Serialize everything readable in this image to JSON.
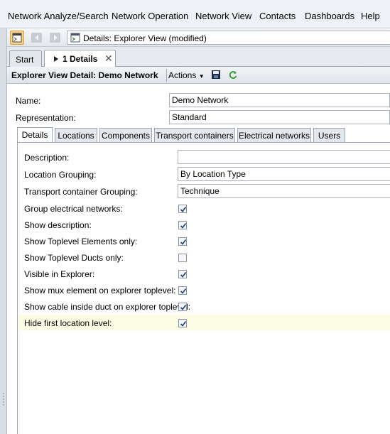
{
  "menu": {
    "items": [
      "Network Analyze/Search",
      "Network Operation",
      "Network View",
      "Contacts",
      "Dashboards",
      "Help"
    ]
  },
  "toolbar": {
    "address_text": "Details: Explorer View  (modified)",
    "icons": [
      "home-view-icon",
      "back-arrow-icon",
      "forward-arrow-icon",
      "view-page-icon"
    ]
  },
  "doc_tabs": {
    "start": "Start",
    "details": "1 Details"
  },
  "view_header": {
    "title": "Explorer View Detail: Demo Network",
    "actions": "Actions",
    "icons": [
      "save-icon",
      "refresh-icon"
    ]
  },
  "form": {
    "name_label": "Name:",
    "name_value": "Demo Network",
    "representation_label": "Representation:",
    "representation_value": "Standard"
  },
  "subtabs": [
    "Details",
    "Locations",
    "Components",
    "Transport containers",
    "Electrical networks",
    "Users"
  ],
  "details": {
    "description_label": "Description:",
    "description_value": "",
    "location_grouping_label": "Location Grouping:",
    "location_grouping_value": "By Location Type",
    "transport_grouping_label": "Transport container Grouping:",
    "transport_grouping_value": "Technique",
    "checkboxes": [
      {
        "label": "Group electrical networks:",
        "checked": true
      },
      {
        "label": "Show description:",
        "checked": true
      },
      {
        "label": "Show Toplevel Elements only:",
        "checked": true
      },
      {
        "label": "Show Toplevel Ducts only:",
        "checked": false
      },
      {
        "label": "Visible in Explorer:",
        "checked": true
      },
      {
        "label": "Show mux element on explorer toplevel:",
        "checked": true
      },
      {
        "label": "Show cable inside duct on explorer toplevel:",
        "checked": true
      },
      {
        "label": "Hide first location level:",
        "checked": true
      }
    ]
  },
  "colors": {
    "highlight_row": "#fdfde6",
    "check_color": "#1f3f7a"
  }
}
